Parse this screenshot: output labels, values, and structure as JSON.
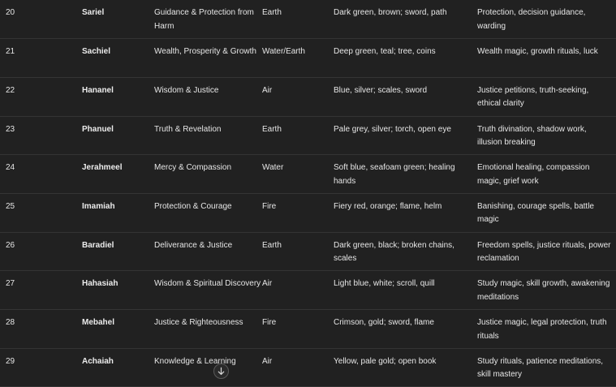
{
  "table": {
    "rows": [
      {
        "num": "20",
        "name": "Sariel",
        "domain": "Guidance & Protection from Harm",
        "element": "Earth",
        "colors_symbols": "Dark green, brown; sword, path",
        "magical_uses": "Protection, decision guidance, warding"
      },
      {
        "num": "21",
        "name": "Sachiel",
        "domain": "Wealth, Prosperity & Growth",
        "element": "Water/Earth",
        "colors_symbols": "Deep green, teal; tree, coins",
        "magical_uses": "Wealth magic, growth rituals, luck"
      },
      {
        "num": "22",
        "name": "Hananel",
        "domain": "Wisdom & Justice",
        "element": "Air",
        "colors_symbols": "Blue, silver; scales, sword",
        "magical_uses": "Justice petitions, truth-seeking, ethical clarity"
      },
      {
        "num": "23",
        "name": "Phanuel",
        "domain": "Truth & Revelation",
        "element": "Earth",
        "colors_symbols": "Pale grey, silver; torch, open eye",
        "magical_uses": "Truth divination, shadow work, illusion breaking"
      },
      {
        "num": "24",
        "name": "Jerahmeel",
        "domain": "Mercy & Compassion",
        "element": "Water",
        "colors_symbols": "Soft blue, seafoam green; healing hands",
        "magical_uses": "Emotional healing, compassion magic, grief work"
      },
      {
        "num": "25",
        "name": "Imamiah",
        "domain": "Protection & Courage",
        "element": "Fire",
        "colors_symbols": "Fiery red, orange; flame, helm",
        "magical_uses": "Banishing, courage spells, battle magic"
      },
      {
        "num": "26",
        "name": "Baradiel",
        "domain": "Deliverance & Justice",
        "element": "Earth",
        "colors_symbols": "Dark green, black; broken chains, scales",
        "magical_uses": "Freedom spells, justice rituals, power reclamation"
      },
      {
        "num": "27",
        "name": "Hahasiah",
        "domain": "Wisdom & Spiritual Discovery",
        "element": "Air",
        "colors_symbols": "Light blue, white; scroll, quill",
        "magical_uses": "Study magic, skill growth, awakening meditations"
      },
      {
        "num": "28",
        "name": "Mebahel",
        "domain": "Justice & Righteousness",
        "element": "Fire",
        "colors_symbols": "Crimson, gold; sword, flame",
        "magical_uses": "Justice magic, legal protection, truth rituals"
      },
      {
        "num": "29",
        "name": "Achaiah",
        "domain": "Knowledge & Learning",
        "element": "Air",
        "colors_symbols": "Yellow, pale gold; open book",
        "magical_uses": "Study rituals, patience meditations, skill mastery"
      }
    ]
  },
  "scroll_button": {
    "icon": "arrow-down-icon"
  },
  "colors": {
    "background": "#212121",
    "text": "#e6e6e6",
    "divider": "#343434"
  }
}
